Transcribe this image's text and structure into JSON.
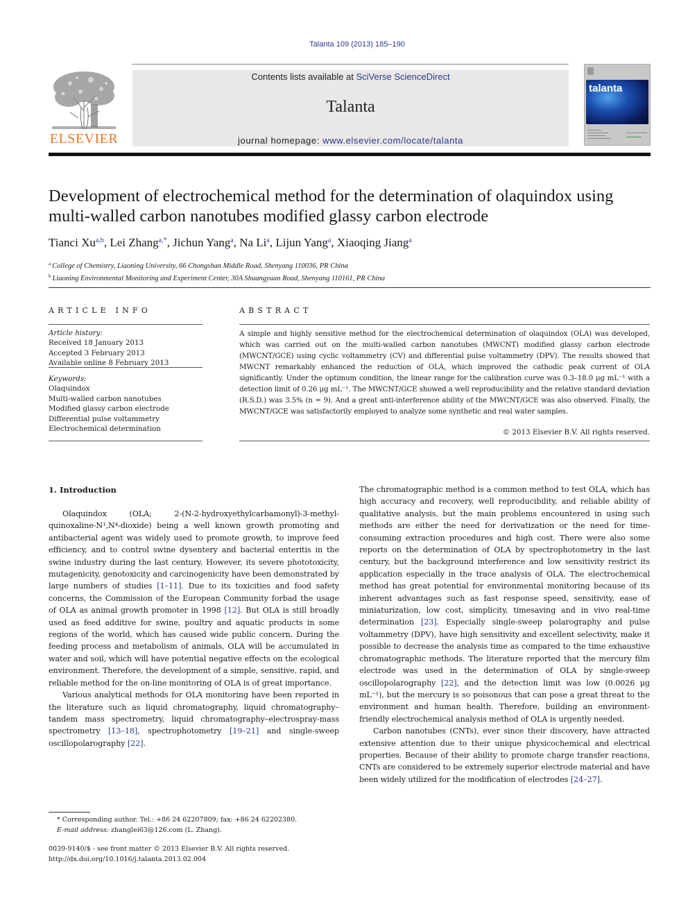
{
  "header": {
    "journal_ref": "Talanta 109 (2013) 185–190",
    "contents_prefix": "Contents lists available at ",
    "contents_link": "SciVerse ScienceDirect",
    "journal_name": "Talanta",
    "homepage_prefix": "journal homepage: ",
    "homepage_link": "www.elsevier.com/locate/talanta",
    "publisher_logo_text": "ELSEVIER",
    "cover_title": "talanta"
  },
  "colors": {
    "link": "#2a3a8c",
    "publisher_orange": "#e87722",
    "masthead_bg": "#e8e8e8"
  },
  "article": {
    "title": "Development of electrochemical method for the determination of olaquindox using multi-walled carbon nanotubes modified glassy carbon electrode",
    "authors": [
      {
        "name": "Tianci Xu",
        "sup": "a,b"
      },
      {
        "name": "Lei Zhang",
        "sup": "a,*"
      },
      {
        "name": "Jichun Yang",
        "sup": "a"
      },
      {
        "name": "Na Li",
        "sup": "a"
      },
      {
        "name": "Lijun Yang",
        "sup": "a"
      },
      {
        "name": "Xiaoqing Jiang",
        "sup": "a"
      }
    ],
    "affiliations": [
      {
        "mark": "a",
        "text": "College of Chemistry, Liaoning University, 66 Chongshan Middle Road, Shenyang 110036, PR China"
      },
      {
        "mark": "b",
        "text": "Liaoning Environmental Monitoring and Experiment Center, 30A Shuangyuan Road, Shenyang 110161, PR China"
      }
    ]
  },
  "article_info": {
    "heading": "ARTICLE INFO",
    "history_label": "Article history:",
    "history": [
      "Received 18 January 2013",
      "Accepted 3 February 2013",
      "Available online 8 February 2013"
    ],
    "keywords_label": "Keywords:",
    "keywords": [
      "Olaquindox",
      "Multi-walled carbon nanotubes",
      "Modified glassy carbon electrode",
      "Differential pulse voltammetry",
      "Electrochemical determination"
    ]
  },
  "abstract": {
    "heading": "ABSTRACT",
    "text": "A simple and highly sensitive method for the electrochemical determination of olaquindox (OLA) was developed, which was carried out on the multi-walled carbon nanotubes (MWCNT) modified glassy carbon electrode (MWCNT/GCE) using cyclic voltammetry (CV) and differential pulse voltammetry (DPV). The results showed that MWCNT remarkably enhanced the reduction of OLA, which improved the cathodic peak current of OLA significantly. Under the optimum condition, the linear range for the calibration curve was 0.3–18.0 μg mL⁻¹ with a detection limit of 0.26 μg mL⁻¹. The MWCNT/GCE showed a well reproducibility and the relative standard deviation (R.S.D.) was 3.5% (n = 9). And a great anti-interference ability of the MWCNT/GCE was also observed. Finally, the MWCNT/GCE was satisfactorily employed to analyze some synthetic and real water samples.",
    "copyright": "© 2013 Elsevier B.V. All rights reserved."
  },
  "introduction": {
    "heading": "1.  Introduction",
    "left_paragraphs": [
      [
        {
          "t": "Olaquindox (OLA; 2-(N-2-hydroxyethylcarbamonyl)-3-methyl-quinoxaline-N¹,N⁴-dioxide) being a well known growth promoting and antibacterial agent was widely used to promote growth, to improve feed efficiency, and to control swine dysentery and bacterial enteritis in the swine industry during the last century. However, its severe phototoxicity, mutagenicity, genotoxicity and carcinogenicity have been demonstrated by large numbers of studies "
        },
        {
          "ref": "[1–11]"
        },
        {
          "t": ". Due to its toxicities and food safety concerns, the Commission of the European Community forbad the usage of OLA as animal growth promoter in 1998 "
        },
        {
          "ref": "[12]"
        },
        {
          "t": ". But OLA is still broadly used as feed additive for swine, poultry and aquatic products in some regions of the world, which has caused wide public concern. During the feeding process and metabolism of animals, OLA will be accumulated in water and soil, which will have potential negative effects on the ecological environment. Therefore, the development of a simple, sensitive, rapid, and reliable method for the on-line monitoring of OLA is of great importance."
        }
      ],
      [
        {
          "t": "Various analytical methods for OLA monitoring have been reported in the literature such as liquid chromatography, liquid chromatography–tandem mass spectrometry, liquid chromatography–electrospray-mass spectrometry "
        },
        {
          "ref": "[13–18]"
        },
        {
          "t": ", spectrophotometry "
        },
        {
          "ref": "[19–21]"
        },
        {
          "t": " and single-sweep oscillopolarography "
        },
        {
          "ref": "[22]"
        },
        {
          "t": "."
        }
      ]
    ],
    "right_paragraphs": [
      [
        {
          "t": "The chromatographic method is a common method to test OLA, which has high accuracy and recovery, well reproducibility, and reliable ability of qualitative analysis, but the main problems encountered in using such methods are either the need for derivatization or the need for time-consuming extraction procedures and high cost. There were also some reports on the determination of OLA by spectrophotometry in the last century, but the background interference and low sensitivity restrict its application especially in the trace analysis of OLA. The electrochemical method has great potential for environmental monitoring because of its inherent advantages such as fast response speed, sensitivity, ease of miniaturization, low cost, simplicity, timesaving and in vivo real-time determination "
        },
        {
          "ref": "[23]"
        },
        {
          "t": ". Especially single-sweep polarography and pulse voltammetry (DPV), have high sensitivity and excellent selectivity, make it possible to decrease the analysis time as compared to the time exhaustive chromatographic methods. The literature reported that the mercury film electrode was used in the determination of OLA by single-sweep oscillopolarography "
        },
        {
          "ref": "[22]"
        },
        {
          "t": ", and the detection limit was low (0.0026 μg mL⁻¹), but the mercury is so poisonous that can pose a great threat to the environment and human health. Therefore, building an environment-friendly electrochemical analysis method of OLA is urgently needed."
        }
      ],
      [
        {
          "t": "Carbon nanotubes (CNTs), ever since their discovery, have attracted extensive attention due to their unique physicochemical and electrical properties. Because of their ability to promote charge transfer reactions, CNTs are considered to be extremely superior electrode material and have been widely utilized for the modification of electrodes "
        },
        {
          "ref": "[24–27]"
        },
        {
          "t": "."
        }
      ]
    ]
  },
  "footnotes": {
    "corresponding": "* Corresponding author. Tel.: +86 24 62207809; fax: +86 24 62202380.",
    "email_label": "E-mail address:",
    "email_value": " zhanglei63@126.com (L. Zhang).",
    "issn": "0039-9140/$ - see front matter © 2013 Elsevier B.V. All rights reserved.",
    "doi": "http://dx.doi.org/10.1016/j.talanta.2013.02.004"
  }
}
